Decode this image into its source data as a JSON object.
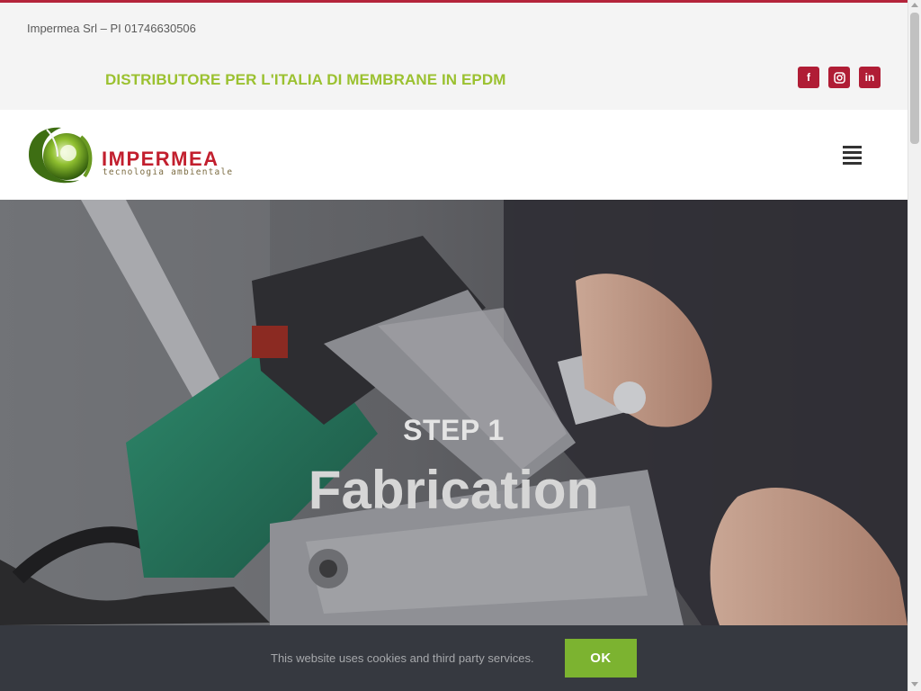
{
  "topbar": {
    "company": "Impermea Srl – PI 01746630506",
    "tagline": "DISTRIBUTORE PER L'ITALIA DI MEMBRANE IN EPDM",
    "social": [
      {
        "name": "facebook",
        "glyph": "f"
      },
      {
        "name": "instagram",
        "glyph": "◎"
      },
      {
        "name": "linkedin",
        "glyph": "in"
      }
    ]
  },
  "header": {
    "logo_text": "IMPERMEA",
    "logo_subtitle": "tecnologia ambientale",
    "menu_icon": "hamburger-icon"
  },
  "hero": {
    "step": "STEP 1",
    "title": "Fabrication"
  },
  "cookie": {
    "text": "This website uses cookies and third party services.",
    "ok_label": "OK"
  },
  "colors": {
    "accent_red": "#b01d35",
    "tagline_green": "#9bc130",
    "ok_green": "#7cb330",
    "cookie_bg": "#363940"
  }
}
